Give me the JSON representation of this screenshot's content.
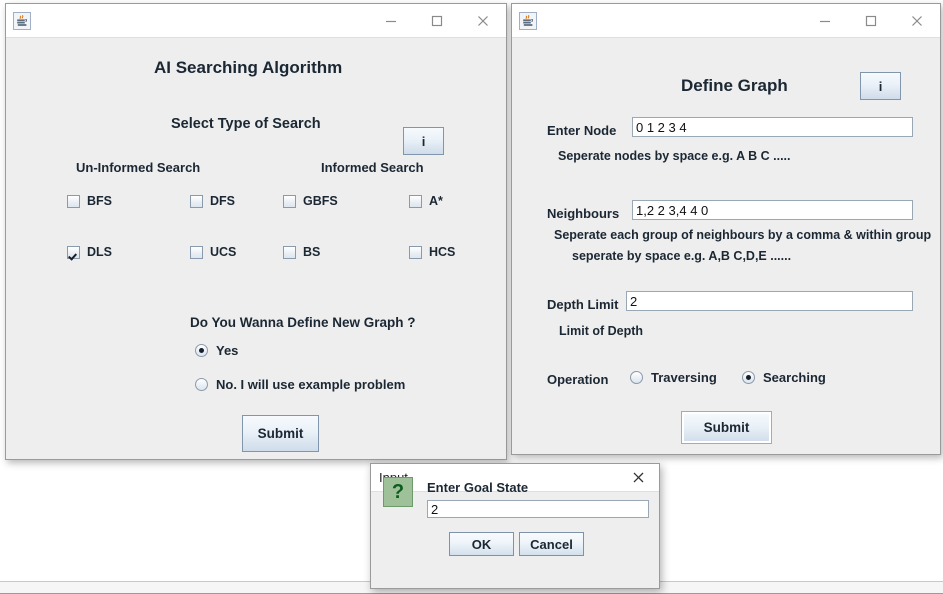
{
  "windows": {
    "left": {
      "icon": "java-icon",
      "controls": {
        "minimize": "minimize-icon",
        "maximize": "maximize-icon",
        "close": "close-icon"
      },
      "title": "AI Searching Algorithm",
      "subtitle": "Select Type of Search",
      "info_button": "i",
      "columns": {
        "uninformed": "Un-Informed Search",
        "informed": "Informed Search"
      },
      "checkboxes": [
        {
          "label": "BFS",
          "checked": false
        },
        {
          "label": "DFS",
          "checked": false
        },
        {
          "label": "GBFS",
          "checked": false
        },
        {
          "label": "A*",
          "checked": false
        },
        {
          "label": "DLS",
          "checked": true
        },
        {
          "label": "UCS",
          "checked": false
        },
        {
          "label": "BS",
          "checked": false
        },
        {
          "label": "HCS",
          "checked": false
        }
      ],
      "question": "Do You Wanna Define New Graph ?",
      "radios": [
        {
          "label": "Yes",
          "selected": true
        },
        {
          "label": "No. I will use example problem",
          "selected": false
        }
      ],
      "submit_label": "Submit"
    },
    "right": {
      "icon": "java-icon",
      "controls": {
        "minimize": "minimize-icon",
        "maximize": "maximize-icon",
        "close": "close-icon"
      },
      "title": "Define Graph",
      "info_button": "i",
      "fields": {
        "node": {
          "label": "Enter Node",
          "value": "0 1 2 3 4",
          "hint": "Seperate nodes by space e.g. A B C ....."
        },
        "neighbours": {
          "label": "Neighbours",
          "value": "1,2 2 3,4 4 0",
          "hint_line1": "Seperate each group of neighbours by a comma & within group",
          "hint_line2": "seperate by space e.g. A,B C,D,E ......"
        },
        "depth": {
          "label": "Depth Limit",
          "value": "2",
          "hint": "Limit of Depth"
        }
      },
      "operation": {
        "label": "Operation",
        "options": [
          {
            "label": "Traversing",
            "selected": false
          },
          {
            "label": "Searching",
            "selected": true
          }
        ]
      },
      "submit_label": "Submit"
    }
  },
  "dialog": {
    "title": "Input",
    "close_icon": "close-icon",
    "icon": "question-icon",
    "icon_glyph": "?",
    "prompt": "Enter Goal State",
    "value": "2",
    "ok_label": "OK",
    "cancel_label": "Cancel"
  },
  "colors": {
    "window_bg": "#eeeeee",
    "titlebar_bg": "#ffffff",
    "text": "#1b2733",
    "button_accent": "#cfdcea",
    "question_icon_bg": "#9ec19a"
  }
}
